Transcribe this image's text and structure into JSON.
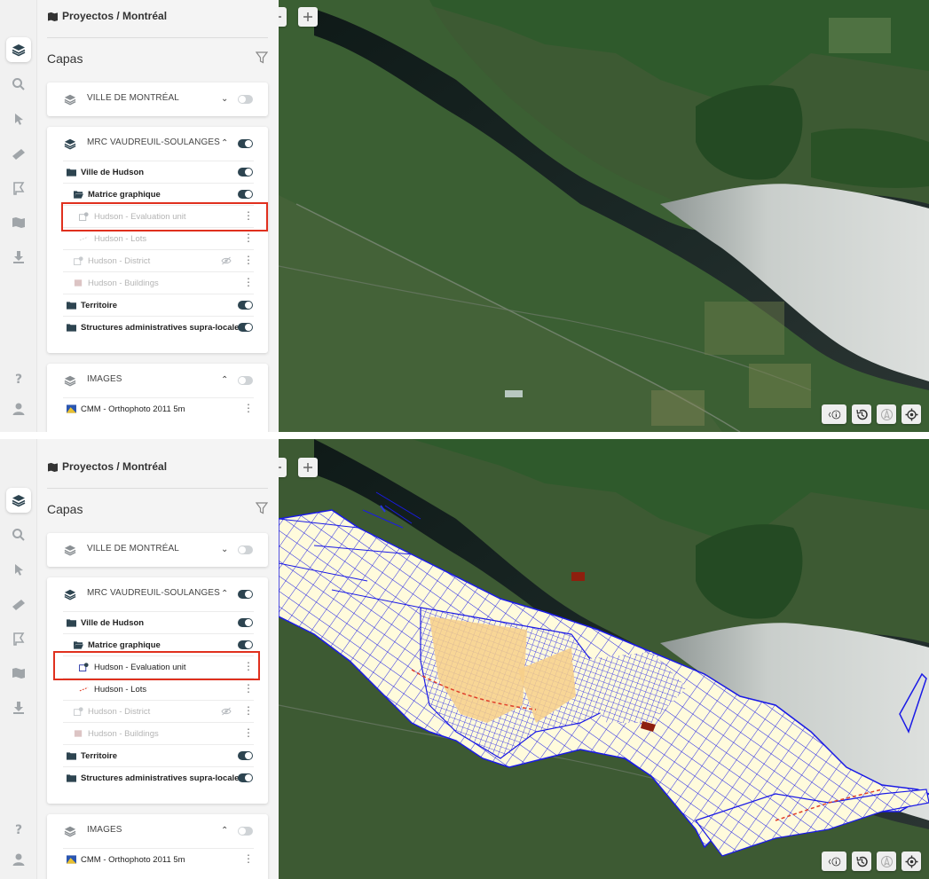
{
  "breadcrumb": "Proyectos / Montréal",
  "panel_title": "Capas",
  "groups": [
    {
      "title": "VILLE DE MONTRÉAL",
      "enabled": false
    },
    {
      "title": "MRC VAUDREUIL-SOULANGES",
      "enabled": true
    },
    {
      "title": "IMAGES",
      "enabled": false
    }
  ],
  "mrc_rows": {
    "hudson": "Ville de Hudson",
    "matrice": "Matrice graphique",
    "eval": "Hudson - Evaluation unit",
    "lots": "Hudson - Lots",
    "district": "Hudson - District",
    "buildings": "Hudson - Buildings",
    "territoire": "Territoire",
    "structures": "Structures administratives supra-locales"
  },
  "images_rows": {
    "ortho": "CMM - Orthophoto 2011 5m"
  },
  "icons": {
    "rail": [
      "layers-icon",
      "search-icon",
      "cursor-icon",
      "ruler-icon",
      "flag-icon",
      "map-icon",
      "download-icon",
      "help-icon",
      "user-icon"
    ],
    "map_top": [
      "back-arrow-icon",
      "plus-icon"
    ],
    "map_bottom": [
      "info-icon",
      "history-icon",
      "compass-icon",
      "locate-icon"
    ]
  },
  "states": {
    "top": "evaluation-unit layer disabled (greyed), parcel overlay hidden",
    "bottom": "evaluation-unit layer enabled, parcel overlay shown on map"
  },
  "colors": {
    "highlight": "#e0301e",
    "toggle_on": "#2d4450",
    "parcel_line": "#1a1ae6",
    "parcel_fill": "#fffbdc"
  }
}
